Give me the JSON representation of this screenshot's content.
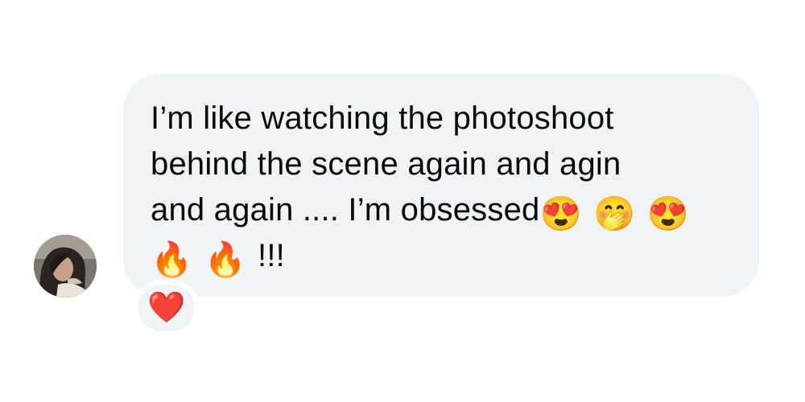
{
  "message": {
    "line1": "I’m like watching the photoshoot",
    "line2": "behind the scene again and agin",
    "line3_text": "and again .... I’m obsessed",
    "line3_emojis": [
      "😍",
      "🤭",
      "😍"
    ],
    "line4_emojis": [
      "🔥",
      "🔥"
    ],
    "line4_text": "!!!"
  },
  "reaction": {
    "emoji": "❤️"
  },
  "colors": {
    "bubble": "#f2f3f5",
    "text": "#0a0a0a",
    "background": "#ffffff"
  },
  "icons": {
    "avatar": "profile-photo",
    "reaction": "red-heart-icon"
  }
}
